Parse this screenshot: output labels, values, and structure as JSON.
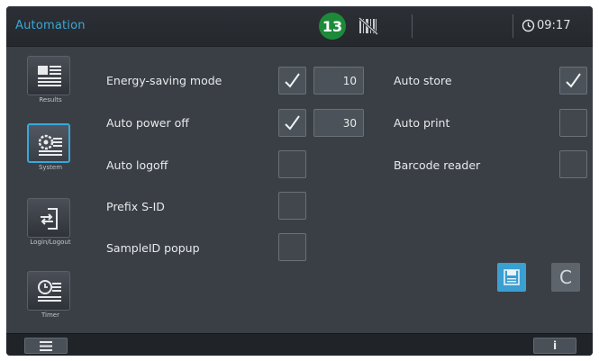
{
  "header": {
    "title": "Automation",
    "badge": "13",
    "scanner_icon": "barcode-disabled-icon",
    "clock_icon": "clock-icon",
    "time": "09:17"
  },
  "sidebar": {
    "items": [
      {
        "label": "Results",
        "icon": "results-icon",
        "active": false
      },
      {
        "label": "System",
        "icon": "system-settings-icon",
        "active": true
      },
      {
        "label": "Login/Logout",
        "icon": "login-logout-icon",
        "active": false
      },
      {
        "label": "Timer",
        "icon": "timer-icon",
        "active": false
      }
    ]
  },
  "options": {
    "energy_saving": {
      "label": "Energy-saving mode",
      "checked": true,
      "value": "10"
    },
    "auto_power_off": {
      "label": "Auto power off",
      "checked": true,
      "value": "30"
    },
    "auto_logoff": {
      "label": "Auto logoff",
      "checked": false
    },
    "prefix_sid": {
      "label": "Prefix S-ID",
      "checked": false
    },
    "sampleid_popup": {
      "label": "SampleID popup",
      "checked": false
    },
    "auto_store": {
      "label": "Auto store",
      "checked": true
    },
    "auto_print": {
      "label": "Auto print",
      "checked": false
    },
    "barcode_reader": {
      "label": "Barcode reader",
      "checked": false
    }
  },
  "actions": {
    "save_icon": "save-icon",
    "cancel_label": "C"
  },
  "footer": {
    "menu_icon": "menu-icon",
    "info_label": "i"
  },
  "colors": {
    "accent": "#39a8d8",
    "badge": "#1d8a3a",
    "background": "#3a3f46"
  }
}
